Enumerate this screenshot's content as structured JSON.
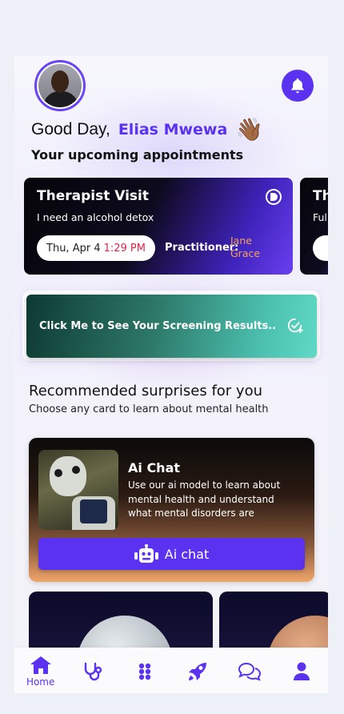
{
  "header": {
    "greeting": "Good Day,",
    "user_name": "Elias Mwewa",
    "wave_emoji": "👋🏾",
    "subtitle": "Your upcoming appointments"
  },
  "appointments": [
    {
      "title": "Therapist Visit",
      "description": "I need an alcohol detox",
      "date": "Thu, Apr 4",
      "time": "1:29 PM",
      "practitioner_label": "Practitioner:",
      "practitioner_name_line1": "Jane",
      "practitioner_name_line2": "Grace"
    },
    {
      "title": "Th",
      "description": "Ful"
    }
  ],
  "screening": {
    "label": "Click Me to See Your Screening Results.."
  },
  "recommended": {
    "title": "Recommended surprises for you",
    "subtitle": "Choose any card to learn about mental health"
  },
  "ai_card": {
    "title": "Ai Chat",
    "description": "Use our ai model to learn about mental health and understand what mental disorders are",
    "button_label": "Ai chat"
  },
  "nav": {
    "items": [
      {
        "label": "Home",
        "icon": "home-icon",
        "active": true
      },
      {
        "label": "",
        "icon": "stethoscope-icon"
      },
      {
        "label": "",
        "icon": "grid-icon"
      },
      {
        "label": "",
        "icon": "rocket-icon"
      },
      {
        "label": "",
        "icon": "chat-icon"
      },
      {
        "label": "",
        "icon": "user-icon"
      }
    ]
  },
  "colors": {
    "accent": "#5a32f0",
    "time": "#e0264a",
    "practitioner_name": "#f4a35f",
    "screening_start": "#0e3a33",
    "screening_end": "#5fd9c6"
  }
}
